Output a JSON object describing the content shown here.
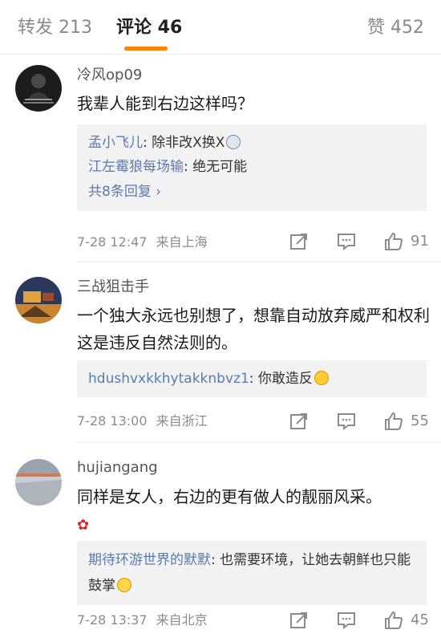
{
  "tabs": [
    {
      "label": "转发 213"
    },
    {
      "label": "评论 46"
    },
    {
      "label": "赞 452"
    }
  ],
  "accent_color": "#ff8200",
  "link_color": "#5b7bb0",
  "comments": [
    {
      "username": "冷风op09",
      "text": "我辈人能到右边这样吗？",
      "replies": [
        {
          "name": "孟小飞儿",
          "text": ": 除非改X换X",
          "emoji": "surprised-face-emoji"
        },
        {
          "name": "江左霉狼每场输",
          "text": ": 绝无可能"
        }
      ],
      "more_replies": "共8条回复 ›",
      "time": "7-28 12:47",
      "source": "来自上海",
      "likes": "91"
    },
    {
      "username": "三战狙击手",
      "text": "一个独大永远也别想了，想靠自动放弃威严和权利这是违反自然法则的。",
      "replies": [
        {
          "name": "hdushvxkkhytakknbvz1",
          "text": ": 你敢造反",
          "emoji": "smiling-face-emoji"
        }
      ],
      "time": "7-28 13:00",
      "source": "来自浙江",
      "likes": "55"
    },
    {
      "username": "hujiangang",
      "text": "同样是女人，右边的更有做人的靓丽风采。",
      "text_emoji": "rose-icon",
      "replies": [
        {
          "name": "期待环游世界的默默",
          "text": ": 也需要环境，让她去朝鲜也只能鼓掌",
          "emoji": "applause-face-emoji"
        }
      ],
      "time": "7-28 13:37",
      "source": "来自北京",
      "likes": "45"
    }
  ]
}
